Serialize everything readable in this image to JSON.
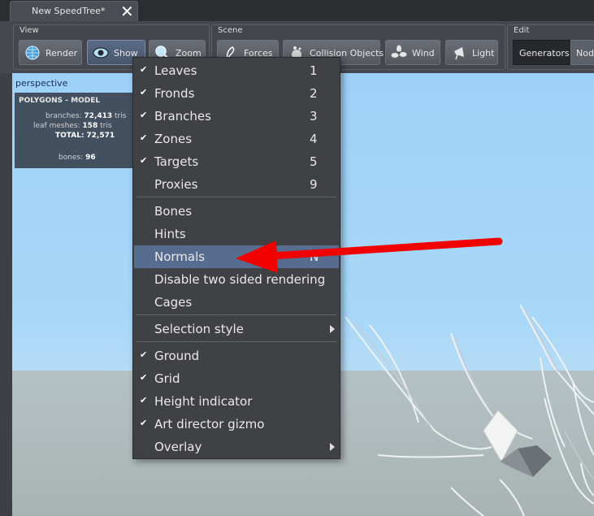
{
  "tab": {
    "title": "New SpeedTree*",
    "close": "✕"
  },
  "toolbar": {
    "view": {
      "label": "View",
      "render": "Render",
      "show": "Show",
      "zoom": "Zoom"
    },
    "scene": {
      "label": "Scene",
      "forces": "Forces",
      "collision": "Collision Objects",
      "wind": "Wind",
      "light": "Light"
    },
    "edit": {
      "label": "Edit",
      "generators": "Generators",
      "nodes": "Node"
    }
  },
  "viewport": {
    "mode": "perspective",
    "stats": {
      "title": "POLYGONS - MODEL",
      "branches_label": "branches:",
      "branches_value": "72,413",
      "branches_unit": "tris",
      "leafmeshes_label": "leaf meshes:",
      "leafmeshes_value": "158",
      "leafmeshes_unit": "tris",
      "total_label": "TOTAL:",
      "total_value": "72,571",
      "bones_label": "bones:",
      "bones_value": "96"
    }
  },
  "menu": {
    "items": [
      {
        "label": "Leaves",
        "shortcut": "1",
        "checked": true
      },
      {
        "label": "Fronds",
        "shortcut": "2",
        "checked": true
      },
      {
        "label": "Branches",
        "shortcut": "3",
        "checked": true
      },
      {
        "label": "Zones",
        "shortcut": "4",
        "checked": true
      },
      {
        "label": "Targets",
        "shortcut": "5",
        "checked": true
      },
      {
        "label": "Proxies",
        "shortcut": "9",
        "checked": false
      },
      {
        "label": "Bones",
        "shortcut": "",
        "checked": false
      },
      {
        "label": "Hints",
        "shortcut": "",
        "checked": false
      },
      {
        "label": "Normals",
        "shortcut": "N",
        "checked": false,
        "highlighted": true
      },
      {
        "label": "Disable two sided rendering",
        "shortcut": "",
        "checked": false
      },
      {
        "label": "Cages",
        "shortcut": "",
        "checked": false
      },
      {
        "label": "Selection style",
        "shortcut": "",
        "checked": false,
        "submenu": true
      },
      {
        "label": "Ground",
        "shortcut": "",
        "checked": true
      },
      {
        "label": "Grid",
        "shortcut": "",
        "checked": true
      },
      {
        "label": "Height indicator",
        "shortcut": "",
        "checked": true
      },
      {
        "label": "Art director gizmo",
        "shortcut": "",
        "checked": true
      },
      {
        "label": "Overlay",
        "shortcut": "",
        "checked": false,
        "submenu": true
      }
    ],
    "check_glyph": "✔"
  },
  "colors": {
    "highlight": "#566d8f",
    "annotation_arrow": "#f20000",
    "sky": "#a8d7f8",
    "ground": "#b0bcbf"
  }
}
